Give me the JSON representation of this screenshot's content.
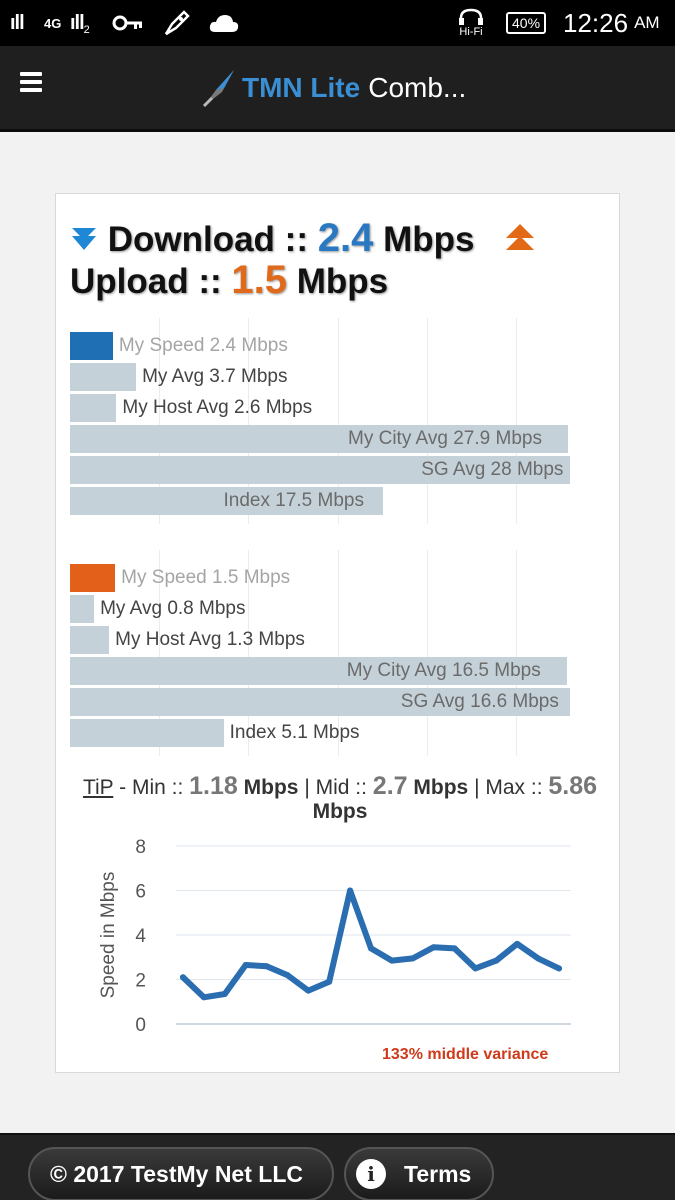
{
  "status_bar": {
    "signal1": "ıll",
    "network": "4G",
    "signal2": "ıll",
    "sim_label": "2",
    "hifi": "Hi-Fi",
    "battery": "40%",
    "time": "12:26",
    "ampm": "AM"
  },
  "app_bar": {
    "title_brand": "TMN Lite",
    "title_rest": "Comb..."
  },
  "summary": {
    "download_label": "Download ::",
    "download_value": "2.4",
    "upload_label": "Upload ::",
    "upload_value": "1.5",
    "unit": "Mbps"
  },
  "download_bars": [
    {
      "label": "My Speed 2.4 Mbps",
      "value": 2.4
    },
    {
      "label": "My Avg 3.7 Mbps",
      "value": 3.7
    },
    {
      "label": "My Host Avg 2.6 Mbps",
      "value": 2.6
    },
    {
      "label": "My City Avg 27.9 Mbps",
      "value": 27.9
    },
    {
      "label": "SG Avg 28 Mbps",
      "value": 28
    },
    {
      "label": "Index 17.5 Mbps",
      "value": 17.5
    }
  ],
  "upload_bars": [
    {
      "label": "My Speed 1.5 Mbps",
      "value": 1.5
    },
    {
      "label": "My Avg 0.8 Mbps",
      "value": 0.8
    },
    {
      "label": "My Host Avg 1.3 Mbps",
      "value": 1.3
    },
    {
      "label": "My City Avg 16.5 Mbps",
      "value": 16.5
    },
    {
      "label": "SG Avg 16.6 Mbps",
      "value": 16.6
    },
    {
      "label": "Index 5.1 Mbps",
      "value": 5.1
    }
  ],
  "colors": {
    "download_accent": "#1f6fb5",
    "upload_accent": "#e2601a",
    "bar_gray": "#c5d1d8",
    "line_blue": "#2a6db0",
    "variance_red": "#cf3a1b"
  },
  "tip": {
    "word": "TiP",
    "min_label": " - Min :: ",
    "min_value": "1.18",
    "mid_label": " | Mid :: ",
    "mid_value": "2.7",
    "max_label": " | Max :: ",
    "max_value": "5.86",
    "unit": "Mbps"
  },
  "chart_data": {
    "type": "line",
    "ylabel": "Speed in Mbps",
    "ylim": [
      0,
      8
    ],
    "yticks": [
      "0",
      "2",
      "4",
      "6",
      "8"
    ],
    "grid": true,
    "series": [
      {
        "values": [
          2.1,
          1.2,
          1.35,
          2.65,
          2.6,
          2.2,
          1.5,
          1.9,
          6.0,
          3.4,
          2.85,
          2.95,
          3.45,
          3.4,
          2.5,
          2.85,
          3.6,
          2.95,
          2.5
        ]
      }
    ]
  },
  "variance_note": "133% middle variance",
  "footer": {
    "copyright": "© 2017 TestMy Net LLC",
    "terms": "Terms",
    "info_glyph": "i"
  }
}
